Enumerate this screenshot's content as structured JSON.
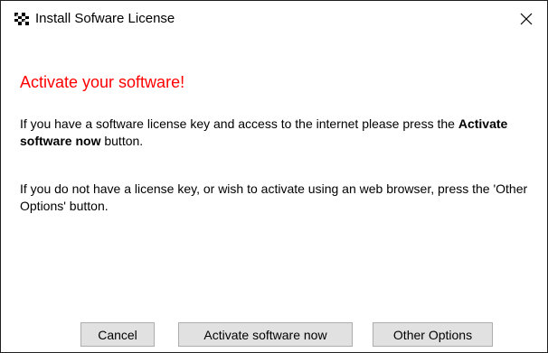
{
  "window": {
    "title": "Install Sofware License",
    "app_icon": "license-app-icon",
    "close_icon": "close-icon"
  },
  "content": {
    "headline": "Activate your software!",
    "paragraph1": {
      "before": "If you have a software license key and access to the internet please press the ",
      "bold": "Activate software now",
      "after": " button."
    },
    "paragraph2": "If you do not have a license key, or wish to activate using an web browser, press the 'Other Options' button."
  },
  "buttons": {
    "cancel": "Cancel",
    "activate": "Activate software now",
    "other": "Other Options"
  },
  "colors": {
    "headline": "#ff0000",
    "button_face": "#e1e1e1",
    "button_border": "#adadad"
  }
}
